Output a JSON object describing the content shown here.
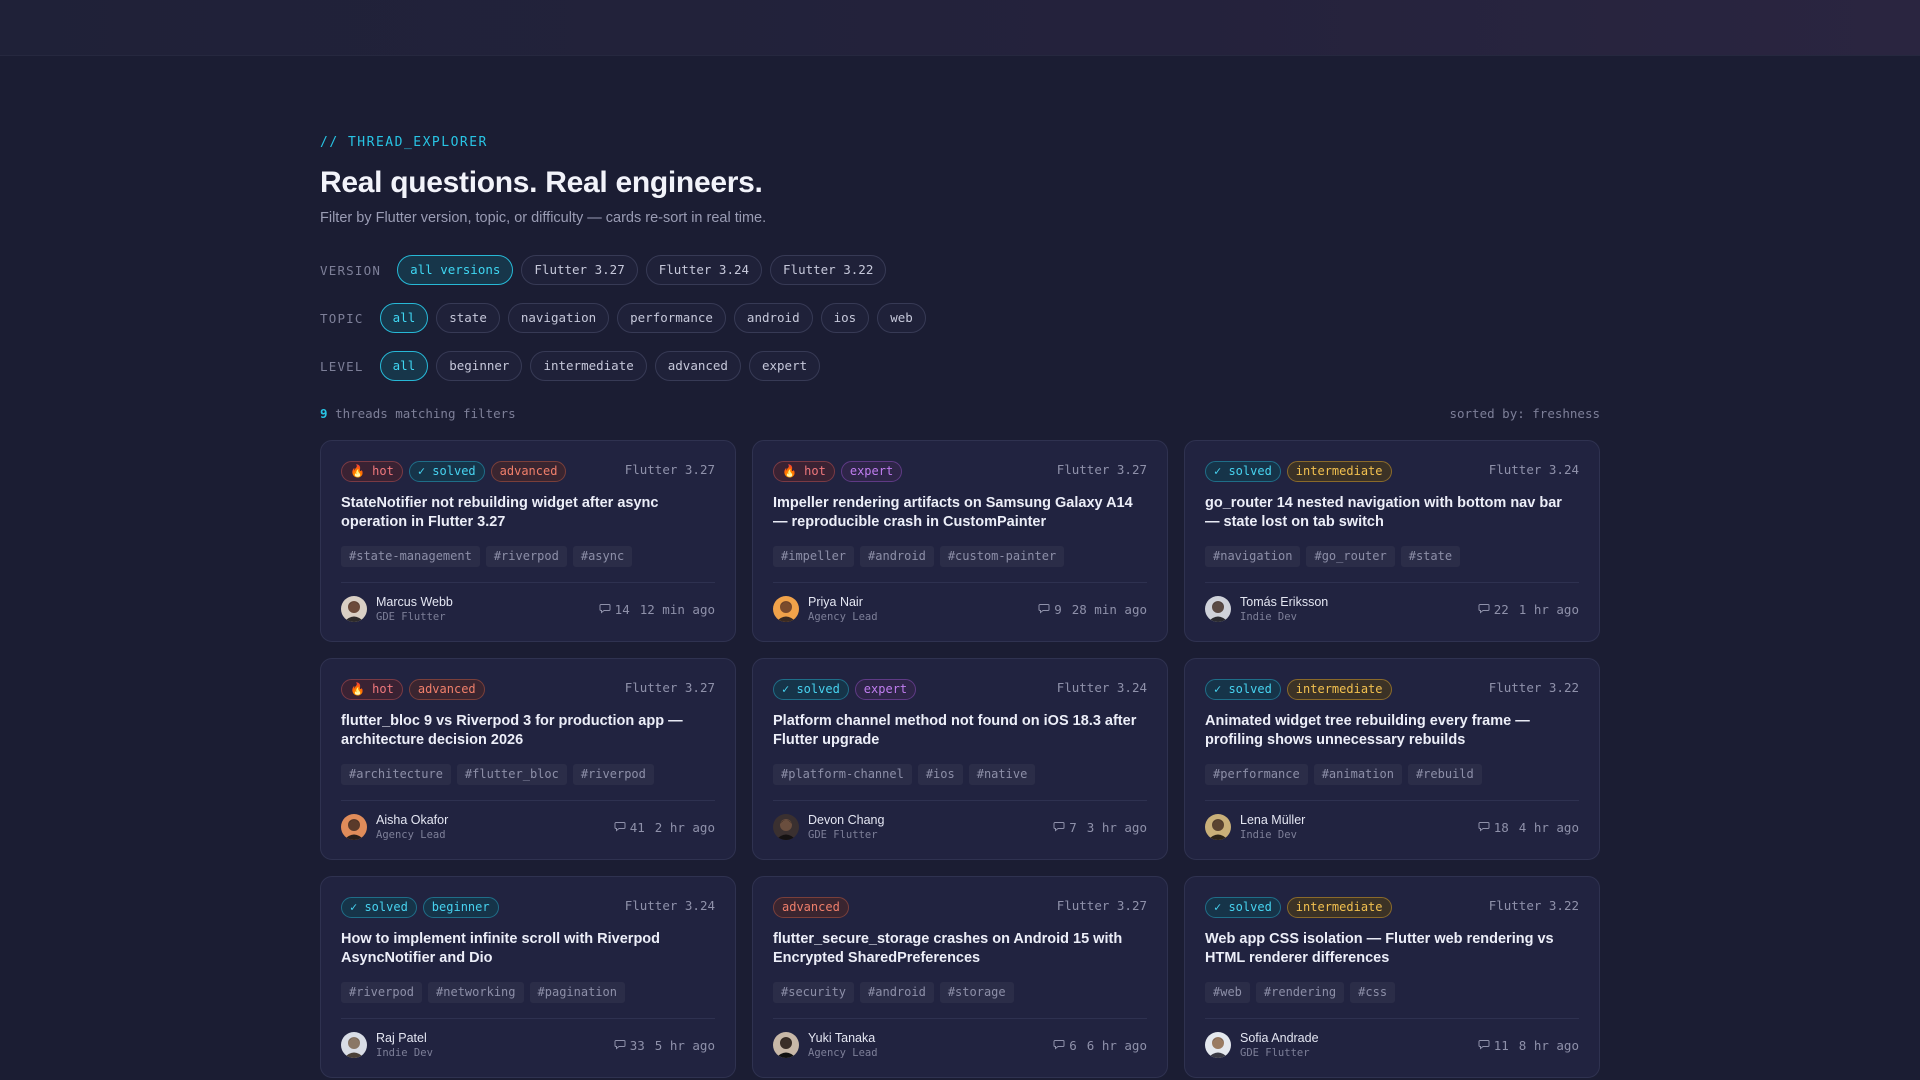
{
  "header": {
    "eyebrow": "// THREAD_EXPLORER",
    "title": "Real questions. Real engineers.",
    "subtitle": "Filter by Flutter version, topic, or difficulty — cards re-sort in real time."
  },
  "filters": {
    "version": {
      "label": "VERSION",
      "options": [
        "all versions",
        "Flutter 3.27",
        "Flutter 3.24",
        "Flutter 3.22"
      ],
      "selected": "all versions"
    },
    "topic": {
      "label": "TOPIC",
      "options": [
        "all",
        "state",
        "navigation",
        "performance",
        "android",
        "ios",
        "web"
      ],
      "selected": "all"
    },
    "level": {
      "label": "LEVEL",
      "options": [
        "all",
        "beginner",
        "intermediate",
        "advanced",
        "expert"
      ],
      "selected": "all"
    }
  },
  "results": {
    "count": "9",
    "count_suffix": "threads matching filters",
    "sort": "sorted by: freshness"
  },
  "colors": {
    "accent": "#28c4e4",
    "background": "#1b1d33",
    "card": "#212340",
    "hot": "#f0787d",
    "expert": "#c07df0",
    "intermediate": "#f2c04f"
  },
  "threads": [
    {
      "badges": [
        {
          "kind": "hot",
          "label": "🔥 hot"
        },
        {
          "kind": "solved",
          "label": "✓ solved"
        },
        {
          "kind": "advanced",
          "label": "advanced"
        }
      ],
      "version": "Flutter 3.27",
      "title": "StateNotifier not rebuilding widget after async operation in Flutter 3.27",
      "tags": [
        "#state-management",
        "#riverpod",
        "#async"
      ],
      "author": "Marcus Webb",
      "role": "GDE Flutter",
      "avatar_icon": "person-avatar-icon",
      "comments": "14",
      "time": "12 min ago"
    },
    {
      "badges": [
        {
          "kind": "hot",
          "label": "🔥 hot"
        },
        {
          "kind": "expert",
          "label": "expert"
        }
      ],
      "version": "Flutter 3.27",
      "title": "Impeller rendering artifacts on Samsung Galaxy A14 — reproducible crash in CustomPainter",
      "tags": [
        "#impeller",
        "#android",
        "#custom-painter"
      ],
      "author": "Priya Nair",
      "role": "Agency Lead",
      "avatar_icon": "person-avatar-icon",
      "comments": "9",
      "time": "28 min ago"
    },
    {
      "badges": [
        {
          "kind": "solved",
          "label": "✓ solved"
        },
        {
          "kind": "intermediate",
          "label": "intermediate"
        }
      ],
      "version": "Flutter 3.24",
      "title": "go_router 14 nested navigation with bottom nav bar — state lost on tab switch",
      "tags": [
        "#navigation",
        "#go_router",
        "#state"
      ],
      "author": "Tomás Eriksson",
      "role": "Indie Dev",
      "avatar_icon": "person-avatar-icon",
      "comments": "22",
      "time": "1 hr ago"
    },
    {
      "badges": [
        {
          "kind": "hot",
          "label": "🔥 hot"
        },
        {
          "kind": "advanced",
          "label": "advanced"
        }
      ],
      "version": "Flutter 3.27",
      "title": "flutter_bloc 9 vs Riverpod 3 for production app — architecture decision 2026",
      "tags": [
        "#architecture",
        "#flutter_bloc",
        "#riverpod"
      ],
      "author": "Aisha Okafor",
      "role": "Agency Lead",
      "avatar_icon": "person-avatar-icon",
      "comments": "41",
      "time": "2 hr ago"
    },
    {
      "badges": [
        {
          "kind": "solved",
          "label": "✓ solved"
        },
        {
          "kind": "expert",
          "label": "expert"
        }
      ],
      "version": "Flutter 3.24",
      "title": "Platform channel method not found on iOS 18.3 after Flutter upgrade",
      "tags": [
        "#platform-channel",
        "#ios",
        "#native"
      ],
      "author": "Devon Chang",
      "role": "GDE Flutter",
      "avatar_icon": "person-avatar-icon",
      "comments": "7",
      "time": "3 hr ago"
    },
    {
      "badges": [
        {
          "kind": "solved",
          "label": "✓ solved"
        },
        {
          "kind": "intermediate",
          "label": "intermediate"
        }
      ],
      "version": "Flutter 3.22",
      "title": "Animated widget tree rebuilding every frame — profiling shows unnecessary rebuilds",
      "tags": [
        "#performance",
        "#animation",
        "#rebuild"
      ],
      "author": "Lena Müller",
      "role": "Indie Dev",
      "avatar_icon": "person-avatar-icon",
      "comments": "18",
      "time": "4 hr ago"
    },
    {
      "badges": [
        {
          "kind": "solved",
          "label": "✓ solved"
        },
        {
          "kind": "beginner",
          "label": "beginner"
        }
      ],
      "version": "Flutter 3.24",
      "title": "How to implement infinite scroll with Riverpod AsyncNotifier and Dio",
      "tags": [
        "#riverpod",
        "#networking",
        "#pagination"
      ],
      "author": "Raj Patel",
      "role": "Indie Dev",
      "avatar_icon": "person-avatar-icon",
      "comments": "33",
      "time": "5 hr ago"
    },
    {
      "badges": [
        {
          "kind": "advanced",
          "label": "advanced"
        }
      ],
      "version": "Flutter 3.27",
      "title": "flutter_secure_storage crashes on Android 15 with Encrypted SharedPreferences",
      "tags": [
        "#security",
        "#android",
        "#storage"
      ],
      "author": "Yuki Tanaka",
      "role": "Agency Lead",
      "avatar_icon": "person-avatar-icon",
      "comments": "6",
      "time": "6 hr ago"
    },
    {
      "badges": [
        {
          "kind": "solved",
          "label": "✓ solved"
        },
        {
          "kind": "intermediate",
          "label": "intermediate"
        }
      ],
      "version": "Flutter 3.22",
      "title": "Web app CSS isolation — Flutter web rendering vs HTML renderer differences",
      "tags": [
        "#web",
        "#rendering",
        "#css"
      ],
      "author": "Sofia Andrade",
      "role": "GDE Flutter",
      "avatar_icon": "person-avatar-icon",
      "comments": "11",
      "time": "8 hr ago"
    }
  ]
}
